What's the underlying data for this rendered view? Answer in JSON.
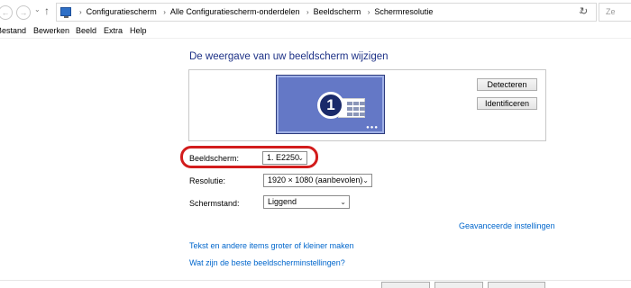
{
  "address_bar": {
    "breadcrumbs": [
      "Configuratiescherm",
      "Alle Configuratiescherm-onderdelen",
      "Beeldscherm",
      "Schermresolutie"
    ],
    "search_placeholder": "Ze"
  },
  "menu": [
    "Bestand",
    "Bewerken",
    "Beeld",
    "Extra",
    "Help"
  ],
  "main": {
    "heading": "De weergave van uw beeldscherm wijzigen",
    "monitor_number": "1",
    "detect_button": "Detecteren",
    "identify_button": "Identificeren",
    "display": {
      "label": "Beeldscherm:",
      "value": "1. E2250"
    },
    "resolution": {
      "label": "Resolutie:",
      "value": "1920 × 1080 (aanbevolen)"
    },
    "orientation": {
      "label": "Schermstand:",
      "value": "Liggend"
    },
    "advanced_link": "Geavanceerde instellingen",
    "link_text_size": "Tekst en andere items groter of kleiner maken",
    "link_best_settings": "Wat zijn de beste beeldscherminstellingen?"
  },
  "colors": {
    "highlight": "#d21c1c",
    "link": "#0066cc",
    "heading": "#1e3287",
    "monitor": "#6478c6"
  }
}
